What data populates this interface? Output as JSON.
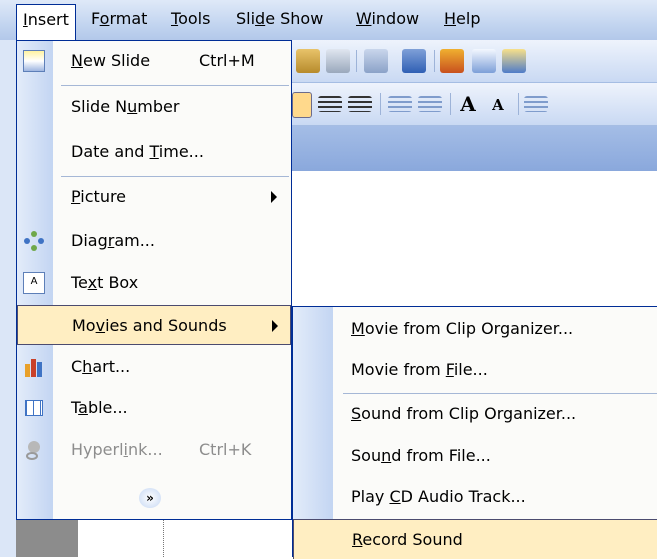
{
  "menubar": {
    "items": [
      {
        "label": "Insert",
        "accel_pre": "",
        "accel": "I",
        "accel_post": "nsert"
      },
      {
        "label": "Format",
        "accel_pre": "F",
        "accel": "o",
        "accel_post": "rmat"
      },
      {
        "label": "Tools",
        "accel_pre": "",
        "accel": "T",
        "accel_post": "ools"
      },
      {
        "label": "Slide Show",
        "accel_pre": "Sli",
        "accel": "d",
        "accel_post": "e Show"
      },
      {
        "label": "Window",
        "accel_pre": "",
        "accel": "W",
        "accel_post": "indow"
      },
      {
        "label": "Help",
        "accel_pre": "",
        "accel": "H",
        "accel_post": "elp"
      }
    ]
  },
  "insert_menu": {
    "items": [
      {
        "pre": "",
        "accel": "N",
        "post": "ew Slide",
        "shortcut": "Ctrl+M"
      },
      {
        "pre": "Slide N",
        "accel": "u",
        "post": "mber",
        "shortcut": ""
      },
      {
        "pre": "Date and ",
        "accel": "T",
        "post": "ime...",
        "shortcut": ""
      },
      {
        "pre": "",
        "accel": "P",
        "post": "icture",
        "shortcut": ""
      },
      {
        "pre": "Diag",
        "accel": "r",
        "post": "am...",
        "shortcut": ""
      },
      {
        "pre": "Te",
        "accel": "x",
        "post": "t Box",
        "shortcut": ""
      },
      {
        "pre": "Mo",
        "accel": "v",
        "post": "ies and Sounds",
        "shortcut": ""
      },
      {
        "pre": "C",
        "accel": "h",
        "post": "art...",
        "shortcut": ""
      },
      {
        "pre": "T",
        "accel": "a",
        "post": "ble...",
        "shortcut": ""
      },
      {
        "pre": "Hyperl",
        "accel": "i",
        "post": "nk...",
        "shortcut": "Ctrl+K"
      }
    ],
    "expand_glyph": "»"
  },
  "submenu": {
    "items": [
      {
        "pre": "",
        "accel": "M",
        "post": "ovie from Clip Organizer..."
      },
      {
        "pre": "Movie from ",
        "accel": "F",
        "post": "ile..."
      },
      {
        "pre": "",
        "accel": "S",
        "post": "ound from Clip Organizer..."
      },
      {
        "pre": "Sou",
        "accel": "n",
        "post": "d from File..."
      },
      {
        "pre": "Play ",
        "accel": "C",
        "post": "D Audio Track..."
      },
      {
        "pre": "",
        "accel": "R",
        "post": "ecord Sound"
      }
    ]
  },
  "colors": {
    "highlight": "#ffeec2",
    "menu_border": "#002d96",
    "gutter": "#c3d5f2",
    "disabled_text": "#8d8d8d"
  }
}
